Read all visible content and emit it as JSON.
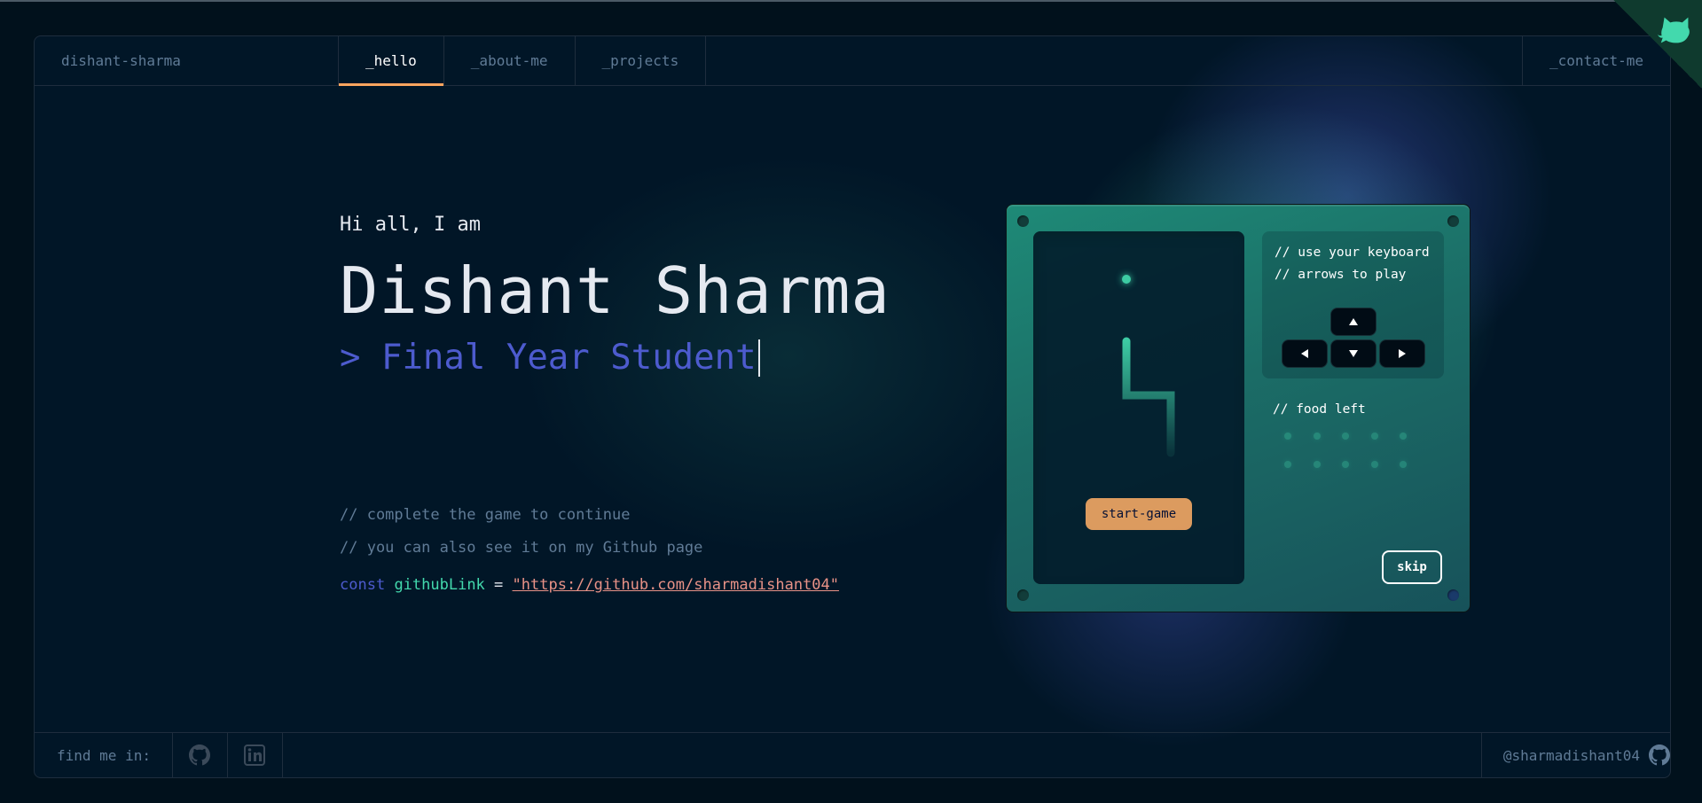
{
  "header": {
    "brand": "dishant-sharma",
    "tabs": [
      {
        "label": "_hello",
        "active": true
      },
      {
        "label": "_about-me",
        "active": false
      },
      {
        "label": "_projects",
        "active": false
      }
    ],
    "contact": "_contact-me"
  },
  "hero": {
    "greeting": "Hi all, I am",
    "name": "Dishant Sharma",
    "role": "> Final Year Student",
    "comment1": "// complete the game to continue",
    "comment2": "// you can also see it on my Github page",
    "code": {
      "keyword": "const",
      "variable": "githubLink",
      "operator": "=",
      "value": "\"https://github.com/sharmadishant04\""
    }
  },
  "game": {
    "instructions_line1": "// use your keyboard",
    "instructions_line2": "// arrows to play",
    "start_label": "start-game",
    "food_left_label": "// food left",
    "food_left_count": 10,
    "skip_label": "skip",
    "keys": [
      "arrow-up-icon",
      "arrow-left-icon",
      "arrow-down-icon",
      "arrow-right-icon"
    ]
  },
  "footer": {
    "find_me": "find me in:",
    "socials": [
      "github-icon",
      "linkedin-icon"
    ],
    "username": "@sharmadishant04"
  },
  "colors": {
    "background": "#011627",
    "accent_orange": "#fea55f",
    "accent_green": "#43d9ad",
    "accent_purple": "#4d5bce",
    "string_red": "#e99287",
    "muted_text": "#607b96"
  }
}
